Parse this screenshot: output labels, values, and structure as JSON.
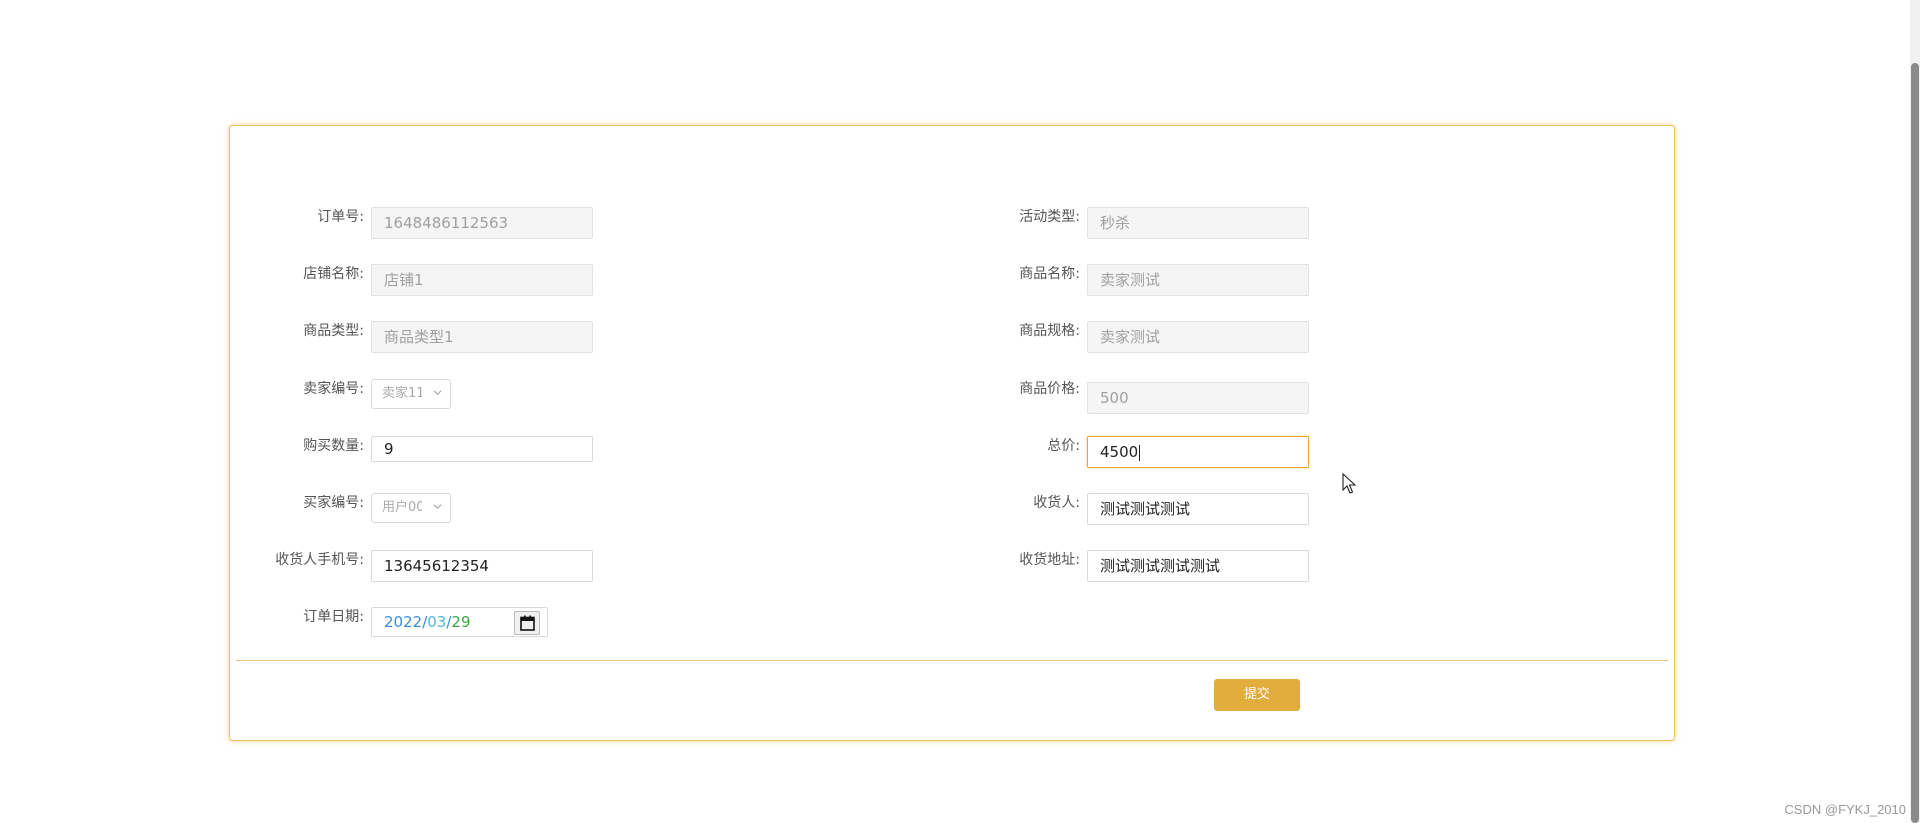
{
  "form": {
    "order_no": {
      "label": "订单号:",
      "value": "1648486112563"
    },
    "activity_type": {
      "label": "活动类型:",
      "value": "秒杀"
    },
    "shop_name": {
      "label": "店铺名称:",
      "value": "店铺1"
    },
    "product_name": {
      "label": "商品名称:",
      "value": "卖家测试"
    },
    "product_type": {
      "label": "商品类型:",
      "value": "商品类型1"
    },
    "product_spec": {
      "label": "商品规格:",
      "value": "卖家测试"
    },
    "seller_no": {
      "label": "卖家编号:",
      "value": "卖家11"
    },
    "product_price": {
      "label": "商品价格:",
      "value": "500"
    },
    "quantity": {
      "label": "购买数量:",
      "value": "9"
    },
    "total_price": {
      "label": "总价:",
      "value": "4500"
    },
    "buyer_no": {
      "label": "买家编号:",
      "value": "用户00"
    },
    "receiver": {
      "label": "收货人:",
      "value": "测试测试测试"
    },
    "receiver_phone": {
      "label": "收货人手机号:",
      "value": "13645612354"
    },
    "address": {
      "label": "收货地址:",
      "value": "测试测试测试测试"
    },
    "order_date": {
      "label": "订单日期:",
      "year": "2022",
      "month": "03",
      "day": "29",
      "sep": "/"
    }
  },
  "submit_label": "提交",
  "watermark": "CSDN @FYKJ_2010",
  "colors": {
    "accent": "#e3ad3d",
    "panel_border": "#f0c060",
    "disabled_bg": "#f5f5f5"
  }
}
